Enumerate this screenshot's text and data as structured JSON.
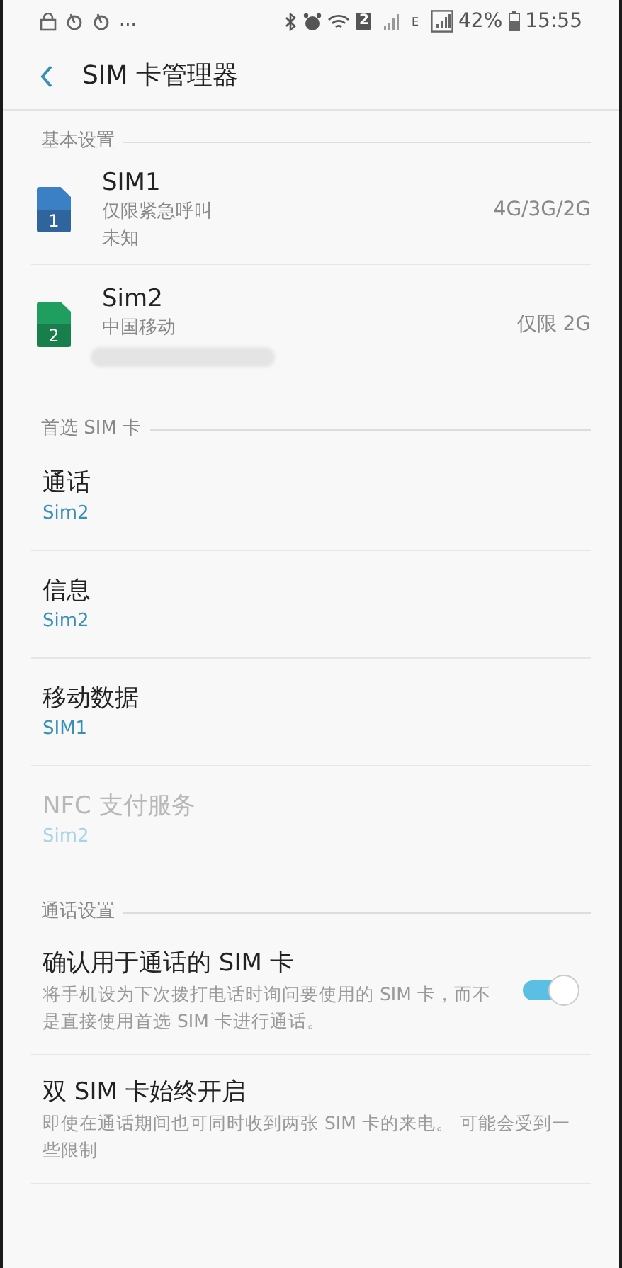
{
  "status_bar": {
    "more": "...",
    "sim_badge": "2",
    "network_type": "E",
    "battery": "42%",
    "time": "15:55"
  },
  "header": {
    "title": "SIM 卡管理器"
  },
  "sections": [
    {
      "title": "基本设置",
      "kind": "sims",
      "items": [
        {
          "name": "SIM1",
          "number": "1",
          "color": "#3b7fc4",
          "status": "仅限紧急呼叫",
          "carrier": "未知",
          "network": "4G/3G/2G",
          "redacted": false
        },
        {
          "name": "Sim2",
          "number": "2",
          "color": "#1f9e5f",
          "status": "中国移动",
          "network": "仅限 2G",
          "redacted": true
        }
      ]
    },
    {
      "title": "首选 SIM 卡",
      "kind": "prefs",
      "items": [
        {
          "label": "通话",
          "value": "Sim2",
          "disabled": false
        },
        {
          "label": "信息",
          "value": "Sim2",
          "disabled": false
        },
        {
          "label": "移动数据",
          "value": "SIM1",
          "disabled": false
        },
        {
          "label": "NFC 支付服务",
          "value": "Sim2",
          "disabled": true
        }
      ]
    },
    {
      "title": "通话设置",
      "kind": "settings",
      "items": [
        {
          "kind": "switch",
          "label": "确认用于通话的 SIM 卡",
          "description": "将手机设为下次拨打电话时询问要使用的 SIM 卡，而不是直接使用首选 SIM 卡进行通话。",
          "on": true
        },
        {
          "kind": "plain",
          "label": "双 SIM 卡始终开启",
          "description": "即使在通话期间也可同时收到两张 SIM 卡的来电。 可能会受到一些限制"
        }
      ]
    }
  ]
}
